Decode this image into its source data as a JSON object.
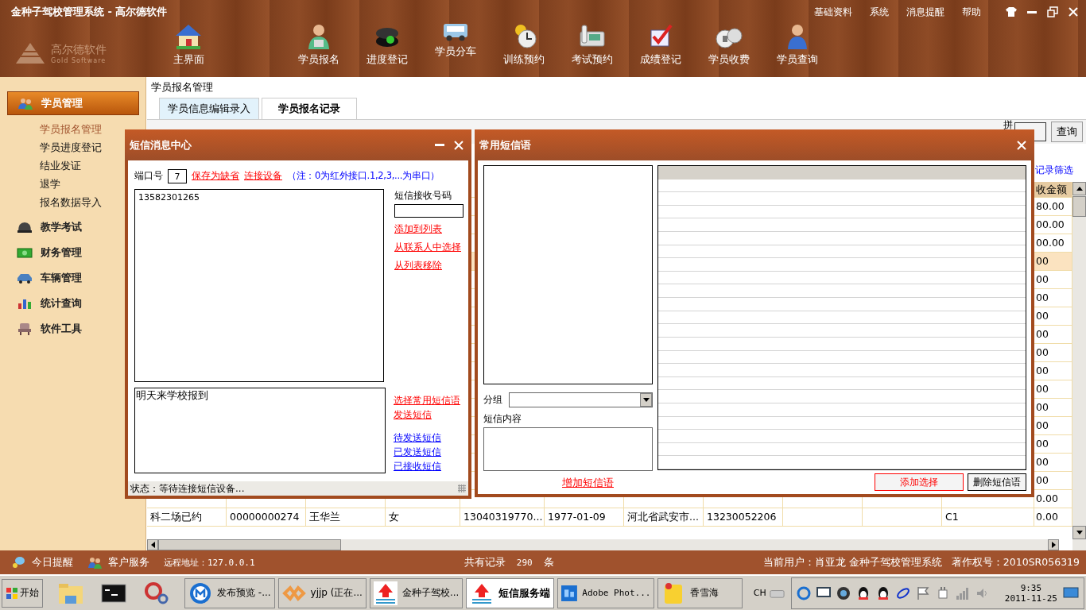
{
  "window": {
    "title": "金种子驾校管理系统 - 高尔德软件",
    "menu": [
      "基础资料",
      "系统",
      "消息提醒",
      "帮助"
    ]
  },
  "logo": {
    "name": "高尔德软件",
    "subtitle": "Gold Software"
  },
  "toolbar": [
    {
      "label": "主界面",
      "kind": "house"
    },
    {
      "label": "学员报名",
      "kind": "person"
    },
    {
      "label": "进度登记",
      "kind": "disc"
    },
    {
      "label": "学员分车",
      "kind": "car"
    },
    {
      "label": "训练预约",
      "kind": "clock"
    },
    {
      "label": "考试预约",
      "kind": "phone"
    },
    {
      "label": "成绩登记",
      "kind": "check"
    },
    {
      "label": "学员收费",
      "kind": "money"
    },
    {
      "label": "学员查询",
      "kind": "user"
    }
  ],
  "sidebar": [
    {
      "label": "学员管理",
      "kind": "people",
      "selected": true,
      "expanded": true,
      "children": [
        {
          "label": "学员报名管理",
          "selected": true
        },
        {
          "label": "学员进度登记",
          "selected": false
        },
        {
          "label": "结业发证",
          "selected": false
        },
        {
          "label": "退学",
          "selected": false
        },
        {
          "label": "报名数据导入",
          "selected": false
        }
      ]
    },
    {
      "label": "教学考试",
      "kind": "helmet",
      "selected": false
    },
    {
      "label": "财务管理",
      "kind": "money",
      "selected": false
    },
    {
      "label": "车辆管理",
      "kind": "car",
      "selected": false
    },
    {
      "label": "统计查询",
      "kind": "chart",
      "selected": false
    },
    {
      "label": "软件工具",
      "kind": "chair",
      "selected": false
    }
  ],
  "breadcrumb": "学员报名管理",
  "tabs": [
    {
      "label": "学员信息编辑录入",
      "selected": false
    },
    {
      "label": "学员报名记录",
      "selected": true
    }
  ],
  "filter": {
    "label": "拼",
    "button": "查询",
    "link": "记录筛选"
  },
  "table": {
    "header": {
      "column_12": "收金额"
    },
    "rows": [
      {
        "column_12": "80.00",
        "selected": false
      },
      {
        "column_12": "00.00",
        "selected": false
      },
      {
        "column_12": "00.00",
        "selected": false
      },
      {
        "column_12": "00",
        "selected": true
      },
      {
        "column_12": "00",
        "selected": false
      },
      {
        "column_12": "00",
        "selected": false
      },
      {
        "column_12": "00",
        "selected": false
      },
      {
        "column_12": "00",
        "selected": false
      },
      {
        "column_12": "00",
        "selected": false
      },
      {
        "column_12": "00",
        "selected": false
      },
      {
        "column_12": "00",
        "selected": false
      },
      {
        "column_12": "00",
        "selected": false
      },
      {
        "column_12": "00",
        "selected": false
      },
      {
        "column_12": "00",
        "selected": false
      },
      {
        "column_12": "00",
        "selected": false
      },
      {
        "column_12": "00",
        "selected": false
      },
      {
        "column_12": "0.00",
        "selected": false
      },
      {
        "column_1": "科二场已约",
        "column_2": "00000000274",
        "column_3": "王华兰",
        "column_4": "女",
        "column_5": "13040319770...",
        "column_6": "1977-01-09",
        "column_7": "河北省武安市...",
        "column_8": "13230052206",
        "column_11": "C1",
        "column_12": "0.00",
        "selected": false
      }
    ]
  },
  "sms_dialog": {
    "title": "短信消息中心",
    "port_label": "端口号",
    "port_value": "7",
    "save_link": "保存为缺省",
    "connect_link": "连接设备",
    "note": "（注：0为红外接口.1,2,3,...为串口）",
    "recipients": [
      "13582301265"
    ],
    "recipient_label": "短信接收号码",
    "recipient_links": [
      "添加到列表",
      "从联系人中选择",
      "从列表移除"
    ],
    "message": "明天来学校报到",
    "action_links": [
      "选择常用短信语",
      "发送短信"
    ],
    "box_links": [
      "待发送短信",
      "已发送短信",
      "已接收短信"
    ],
    "status": "状态：等待连接短信设备..."
  },
  "phrases_dialog": {
    "title": "常用短信语",
    "group_label": "分组",
    "content_label": "短信内容",
    "add_link": "增加短信语",
    "buttons": [
      {
        "label": "添加选择",
        "kind": "primary"
      },
      {
        "label": "删除短信语",
        "kind": "normal"
      }
    ]
  },
  "status_bar": {
    "reminder": "今日提醒",
    "service": "客户服务",
    "remote": "远程地址：127.0.0.1",
    "records_label": "共有记录",
    "records_count": "290",
    "records_unit": "条",
    "user": "当前用户：肖亚龙 金种子驾校管理系统",
    "copyright": "著作权号：2010SR056319"
  },
  "taskbar": {
    "start": "开始",
    "windows": [
      {
        "label": "发布预览 -...",
        "kind": "browser",
        "selected": false
      },
      {
        "label": "yjjp (正在...",
        "kind": "studio",
        "selected": false
      },
      {
        "label": "金种子驾校...",
        "kind": "app",
        "selected": false
      },
      {
        "label": "短信服务端",
        "kind": "app",
        "selected": true
      },
      {
        "label": "Adobe Phot...",
        "kind": "ps",
        "selected": false
      },
      {
        "label": "香雪海",
        "kind": "note",
        "selected": false
      }
    ],
    "language": "CH",
    "time": "9:35",
    "date": "2011-11-25"
  }
}
